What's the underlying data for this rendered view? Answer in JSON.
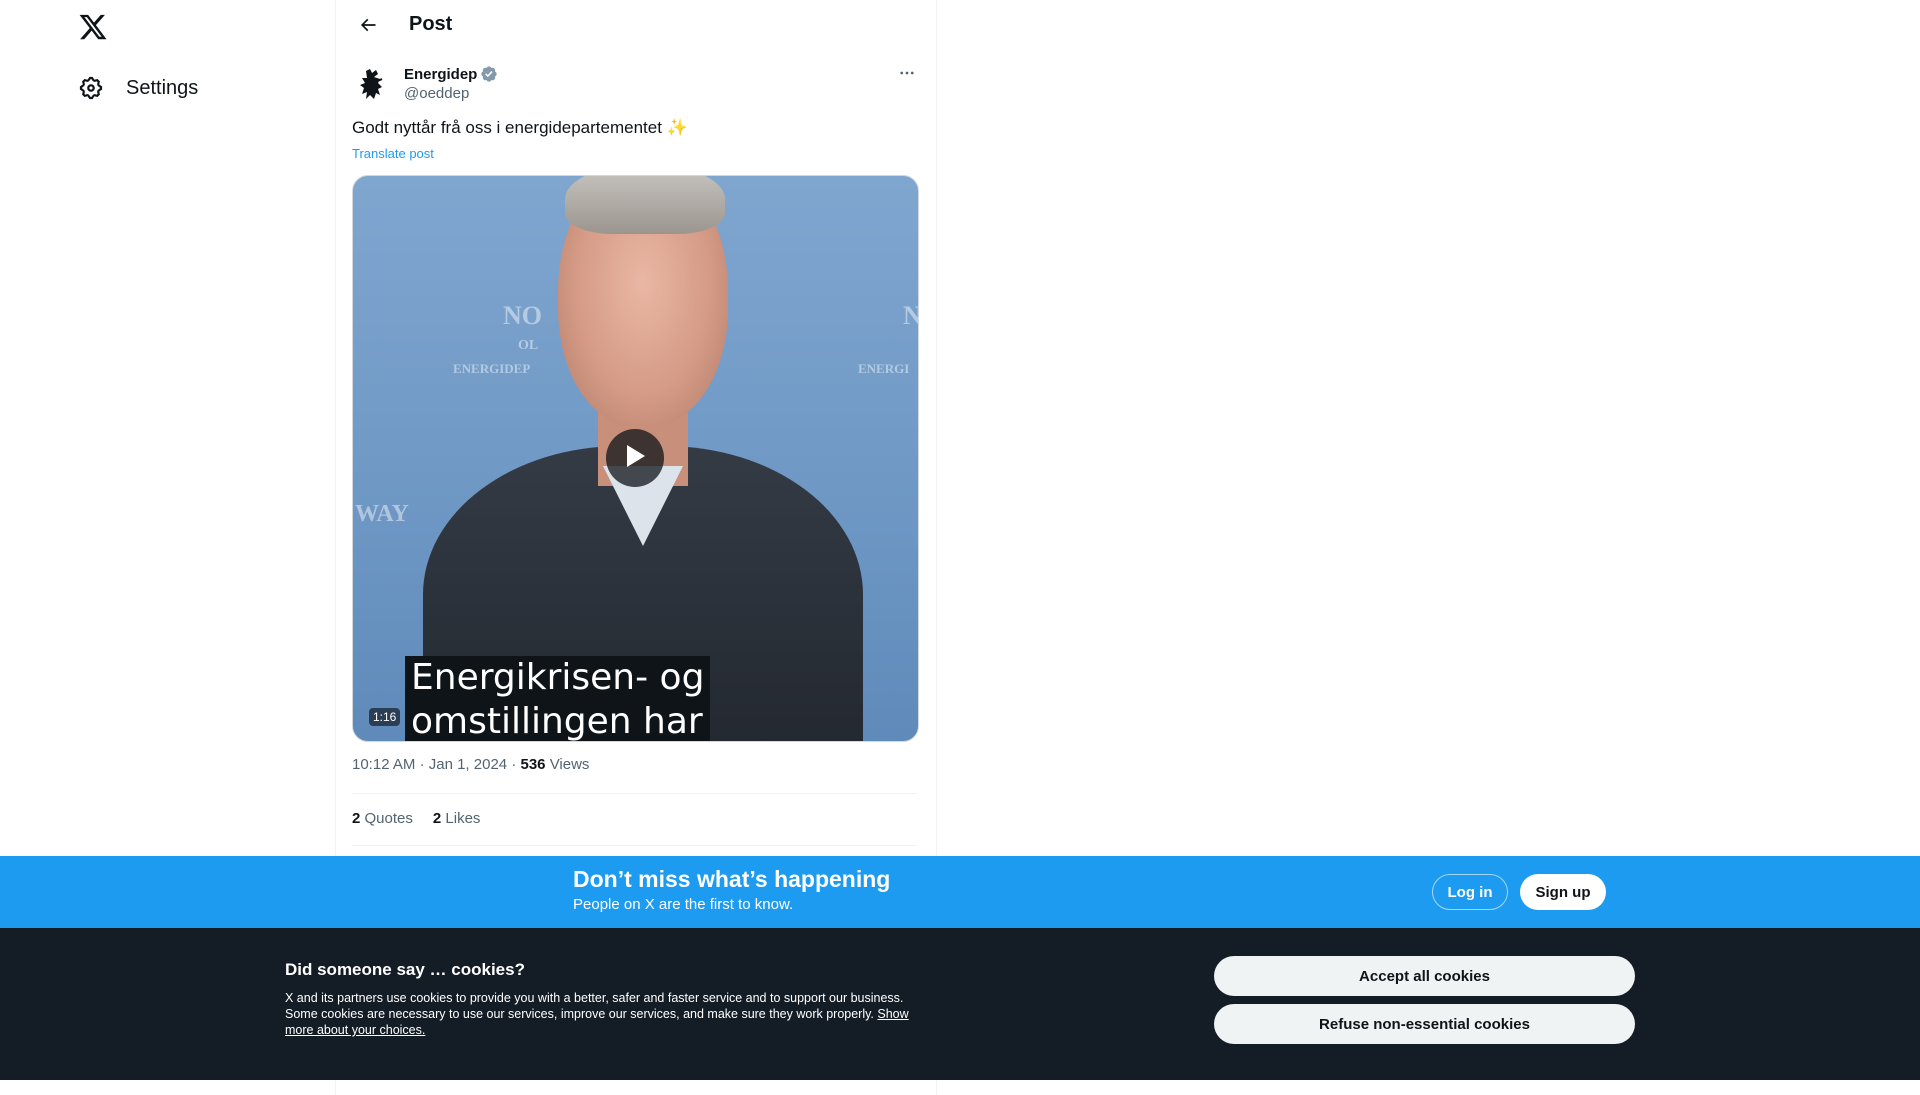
{
  "nav": {
    "logo_icon": "x-logo-icon",
    "settings_label": "Settings"
  },
  "header": {
    "title": "Post"
  },
  "post": {
    "author_name": "Energidep",
    "author_handle": "@oeddep",
    "verified": true,
    "text": "Godt nyttår frå oss i energidepartementet ✨",
    "translate_label": "Translate post",
    "video": {
      "subtitle_line1": "Energikrisen- og",
      "subtitle_line2": "omstillingen har",
      "duration": "1:16",
      "watermark_left": "NO",
      "watermark_left2": "OL",
      "watermark_left3": "ENERGIDEP",
      "watermark_right": "N",
      "watermark_right2": "ENERGI",
      "watermark_way": "WAY"
    },
    "time": "10:12 AM",
    "date": "Jan 1, 2024",
    "views_count": "536",
    "views_label": "Views",
    "quotes_count": "2",
    "quotes_label": "Quotes",
    "likes_count": "2",
    "likes_label": "Likes"
  },
  "signup_bar": {
    "title": "Don’t miss what’s happening",
    "subtitle": "People on X are the first to know.",
    "login_label": "Log in",
    "signup_label": "Sign up"
  },
  "cookies": {
    "title": "Did someone say … cookies?",
    "text": "X and its partners use cookies to provide you with a better, safer and faster service and to support our business. Some cookies are necessary to use our services, improve our services, and make sure they work properly.",
    "link": "Show more about your choices.",
    "accept_label": "Accept all cookies",
    "refuse_label": "Refuse non-essential cookies"
  },
  "colors": {
    "accent": "#1d9bf0",
    "cookie_bg": "#141d26",
    "text_primary": "#0f1419",
    "text_secondary": "#536471"
  }
}
